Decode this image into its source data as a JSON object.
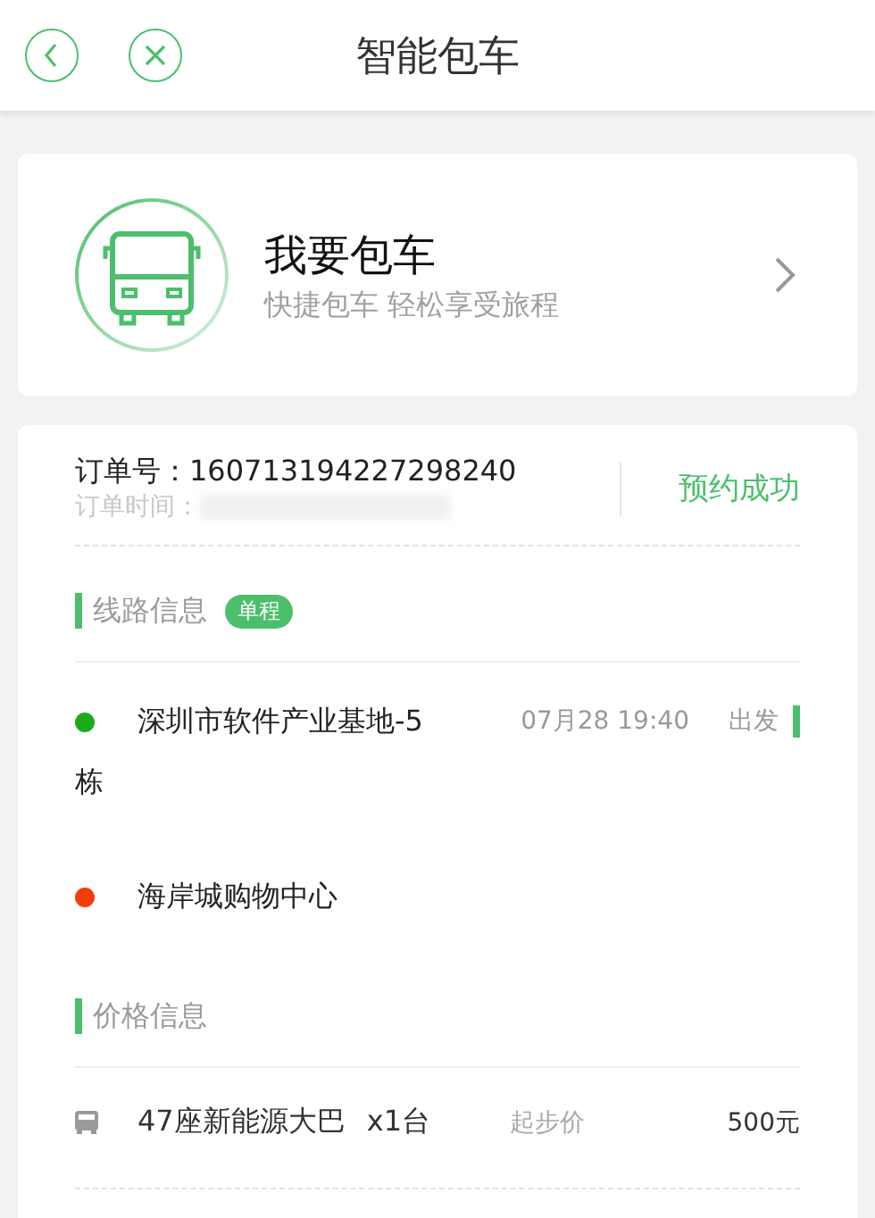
{
  "header": {
    "title": "智能包车"
  },
  "charter_card": {
    "title": "我要包车",
    "subtitle": "快捷包车 轻松享受旅程"
  },
  "order": {
    "number_label": "订单号：",
    "number": "160713194227298240",
    "time_label": "订单时间：",
    "status": "预约成功"
  },
  "route": {
    "heading": "线路信息",
    "badge": "单程",
    "stops": [
      {
        "name": "深圳市软件产业基地-5栋",
        "color": "#1aad19",
        "time": "07月28 19:40",
        "action": "出发"
      },
      {
        "name": "海岸城购物中心",
        "color": "#f23c0c"
      }
    ]
  },
  "price": {
    "heading": "价格信息",
    "items": [
      {
        "vehicle": "47座新能源大巴",
        "quantity": "x1台",
        "price_label": "起步价",
        "price": "500元"
      }
    ]
  }
}
